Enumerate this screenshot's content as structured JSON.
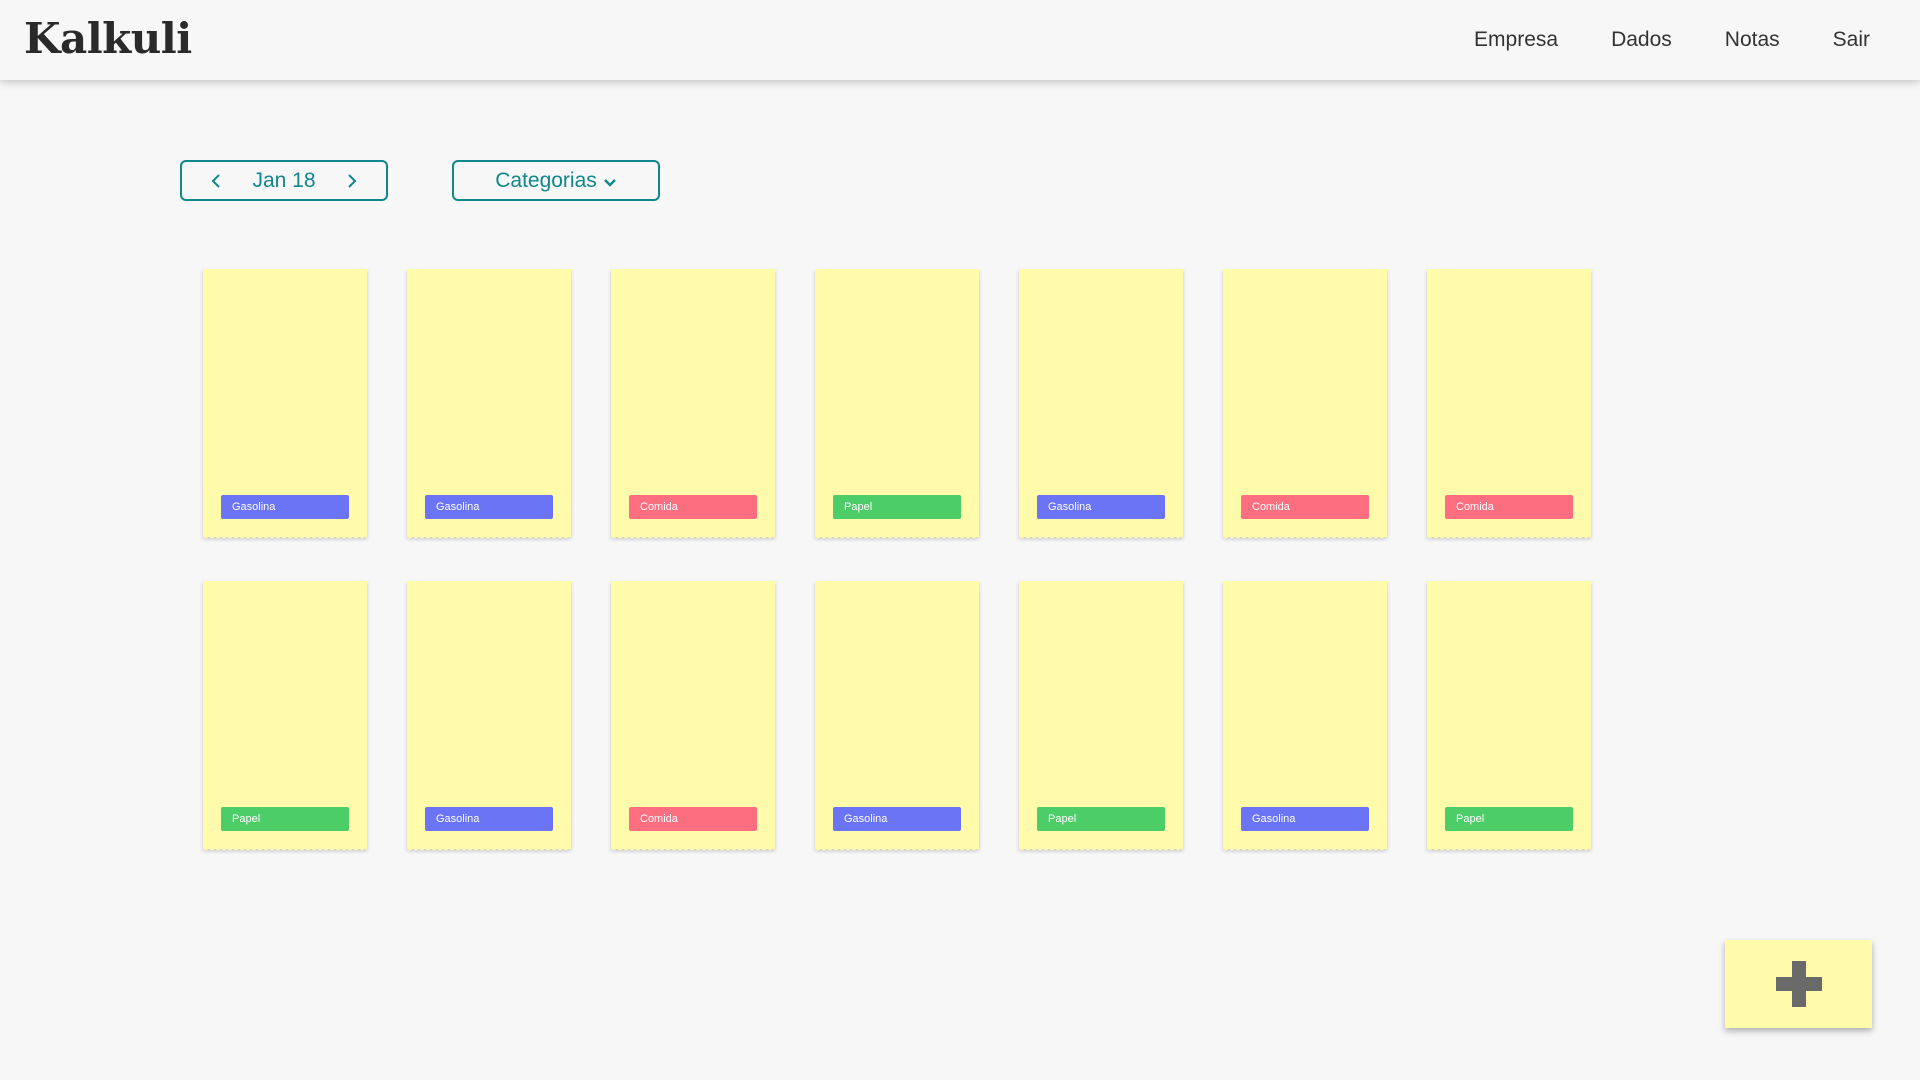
{
  "app": {
    "title": "Kalkuli"
  },
  "nav": {
    "items": [
      "Empresa",
      "Dados",
      "Notas",
      "Sair"
    ]
  },
  "month_selector": {
    "label": "Jan 18",
    "prev_icon": "chevron-left-icon",
    "next_icon": "chevron-right-icon"
  },
  "category_filter": {
    "label": "Categorias",
    "icon": "chevron-down-icon"
  },
  "colors": {
    "accent": "#10878d",
    "note": "#fffbaa",
    "Gasolina": "#6b74f4",
    "Comida": "#fc6e80",
    "Papel": "#4ccd68"
  },
  "notes": [
    {
      "category": "Gasolina"
    },
    {
      "category": "Gasolina"
    },
    {
      "category": "Comida"
    },
    {
      "category": "Papel"
    },
    {
      "category": "Gasolina"
    },
    {
      "category": "Comida"
    },
    {
      "category": "Comida"
    },
    {
      "category": "Papel"
    },
    {
      "category": "Gasolina"
    },
    {
      "category": "Comida"
    },
    {
      "category": "Gasolina"
    },
    {
      "category": "Papel"
    },
    {
      "category": "Gasolina"
    },
    {
      "category": "Papel"
    }
  ],
  "add_button": {
    "icon": "plus-icon"
  }
}
